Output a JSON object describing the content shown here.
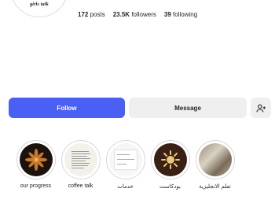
{
  "profile": {
    "logo_text": "girls talk",
    "stats": {
      "posts_count": "172",
      "posts_label": "posts",
      "followers_count": "23.5K",
      "followers_label": "followers",
      "following_count": "39",
      "following_label": "following"
    }
  },
  "actions": {
    "follow_label": "Follow",
    "message_label": "Message",
    "add_user_icon": "add-user-icon"
  },
  "colors": {
    "follow_bg": "#4a5ff4",
    "secondary_bg": "#efefef"
  },
  "highlights": [
    {
      "label": "our progress",
      "cover": "flower-dark"
    },
    {
      "label": "coffee talk",
      "cover": "paper-text"
    },
    {
      "label": "خدمات",
      "cover": "white-card"
    },
    {
      "label": "بودكاست",
      "cover": "sun-brown"
    },
    {
      "label": "تعلم الانجليزية",
      "cover": "photo"
    }
  ]
}
